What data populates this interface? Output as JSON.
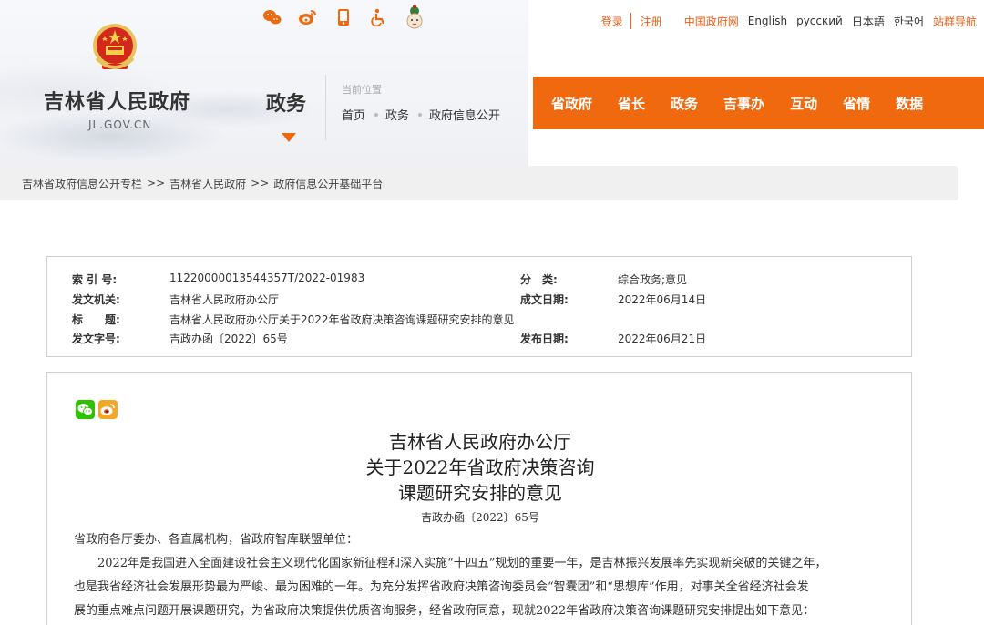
{
  "header": {
    "site_title": "吉林省人民政府",
    "site_domain": "JL.GOV.CN",
    "section_name": "政务",
    "location_label": "当前位置",
    "location_path": [
      "首页",
      "政务",
      "政府信息公开"
    ],
    "social_icons": [
      "weibo-style-icon",
      "sina-weibo-icon",
      "mobile-icon",
      "accessibility-icon",
      "mascot-icon"
    ],
    "top_links": {
      "login": "登录",
      "register": "注册",
      "gov_cn": "中国政府网",
      "english": "English",
      "russian": "русский",
      "japanese": "日本語",
      "korean": "한국어",
      "site_nav": "站群导航"
    },
    "main_nav": [
      "省政府",
      "省长",
      "政务",
      "吉事办",
      "互动",
      "省情",
      "数据"
    ]
  },
  "breadcrumb": [
    "吉林省政府信息公开专栏",
    "吉林省人民政府",
    "政府信息公开基础平台"
  ],
  "breadcrumb_separator": ">>",
  "meta": {
    "index_label": "索 引 号:",
    "index_value": "11220000013544357T/2022-01983",
    "category_label": "分　类:",
    "category_value": "综合政务;意见",
    "issuer_label": "发文机关:",
    "issuer_value": "吉林省人民政府办公厅",
    "created_label": "成文日期:",
    "created_value": "2022年06月14日",
    "title_label": "标　　题:",
    "title_value": "吉林省人民政府办公厅关于2022年省政府决策咨询课题研究安排的意见",
    "docno_label": "发文字号:",
    "docno_value": "吉政办函〔2022〕65号",
    "published_label": "发布日期:",
    "published_value": "2022年06月21日"
  },
  "article": {
    "title_lines": [
      "吉林省人民政府办公厅",
      "关于2022年省政府决策咨询",
      "课题研究安排的意见"
    ],
    "doc_number": "吉政办函〔2022〕65号",
    "salutation": "省政府各厅委办、各直属机构，省政府智库联盟单位：",
    "paragraph_lines": [
      "2022年是我国进入全面建设社会主义现代化国家新征程和深入实施“十四五”规划的重要一年，是吉林振兴发展率先实现新突破的关键之年，",
      "也是我省经济社会发展形势最为严峻、最为困难的一年。为充分发挥省政府决策咨询委员会“智囊团”和“思想库”作用，对事关全省经济社会发",
      "展的重点难点问题开展课题研究，为省政府决策提供优质咨询服务，经省政府同意，现就2022年省政府决策咨询课题研究安排提出如下意见："
    ],
    "share_icons": [
      "wechat-icon",
      "weibo-icon"
    ]
  },
  "colors": {
    "accent": "#f0690e",
    "link_orange": "#e8601a",
    "wechat_green": "#2dc100",
    "weibo_orange": "#f5a623"
  }
}
